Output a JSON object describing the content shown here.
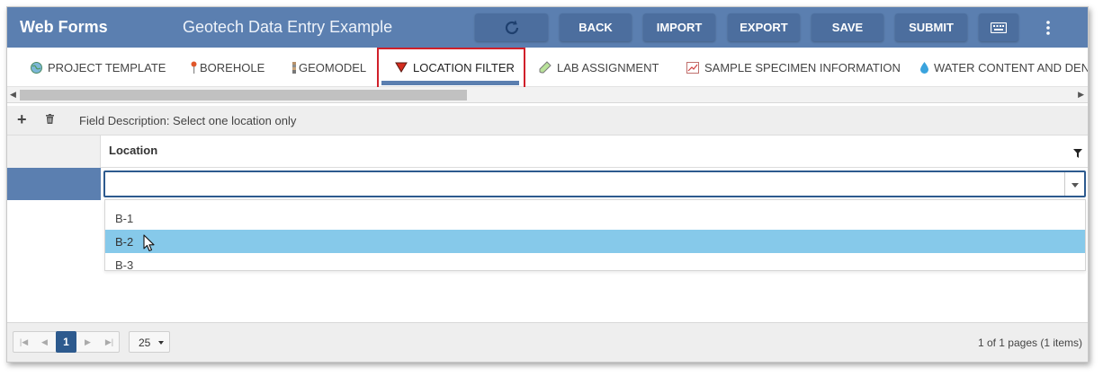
{
  "header": {
    "app_title": "Web Forms",
    "page_title": "Geotech Data Entry Example",
    "buttons": {
      "refresh_icon": "refresh-icon",
      "back": "BACK",
      "import": "IMPORT",
      "export": "EXPORT",
      "save": "SAVE",
      "submit": "SUBMIT",
      "keyboard_icon": "keyboard-icon",
      "more_icon": "more-vertical-icon"
    },
    "colors": {
      "header_bg": "#5b7fb0",
      "button_bg": "#4c6e9e"
    }
  },
  "tabs": [
    {
      "label": "PROJECT TEMPLATE",
      "icon": "globe-icon"
    },
    {
      "label": "BOREHOLE",
      "icon": "pin-icon"
    },
    {
      "label": "GEOMODEL",
      "icon": "layers-icon"
    },
    {
      "label": "LOCATION FILTER",
      "icon": "filter-triangle-icon",
      "active": true
    },
    {
      "label": "LAB ASSIGNMENT",
      "icon": "test-tube-icon"
    },
    {
      "label": "SAMPLE SPECIMEN INFORMATION",
      "icon": "chart-icon"
    },
    {
      "label": "WATER CONTENT AND DENSI",
      "icon": "water-drop-icon"
    }
  ],
  "toolbar": {
    "add_icon": "plus-icon",
    "delete_icon": "trash-icon",
    "field_description": "Field Description: Select one location only"
  },
  "grid": {
    "column_header": "Location",
    "filter_icon": "filter-icon",
    "combo_value": "",
    "options": [
      "B-1",
      "B-2",
      "B-3"
    ],
    "hovered_option": "B-2"
  },
  "footer": {
    "current_page": "1",
    "page_size": "25",
    "page_info": "1 of 1 pages (1 items)"
  }
}
